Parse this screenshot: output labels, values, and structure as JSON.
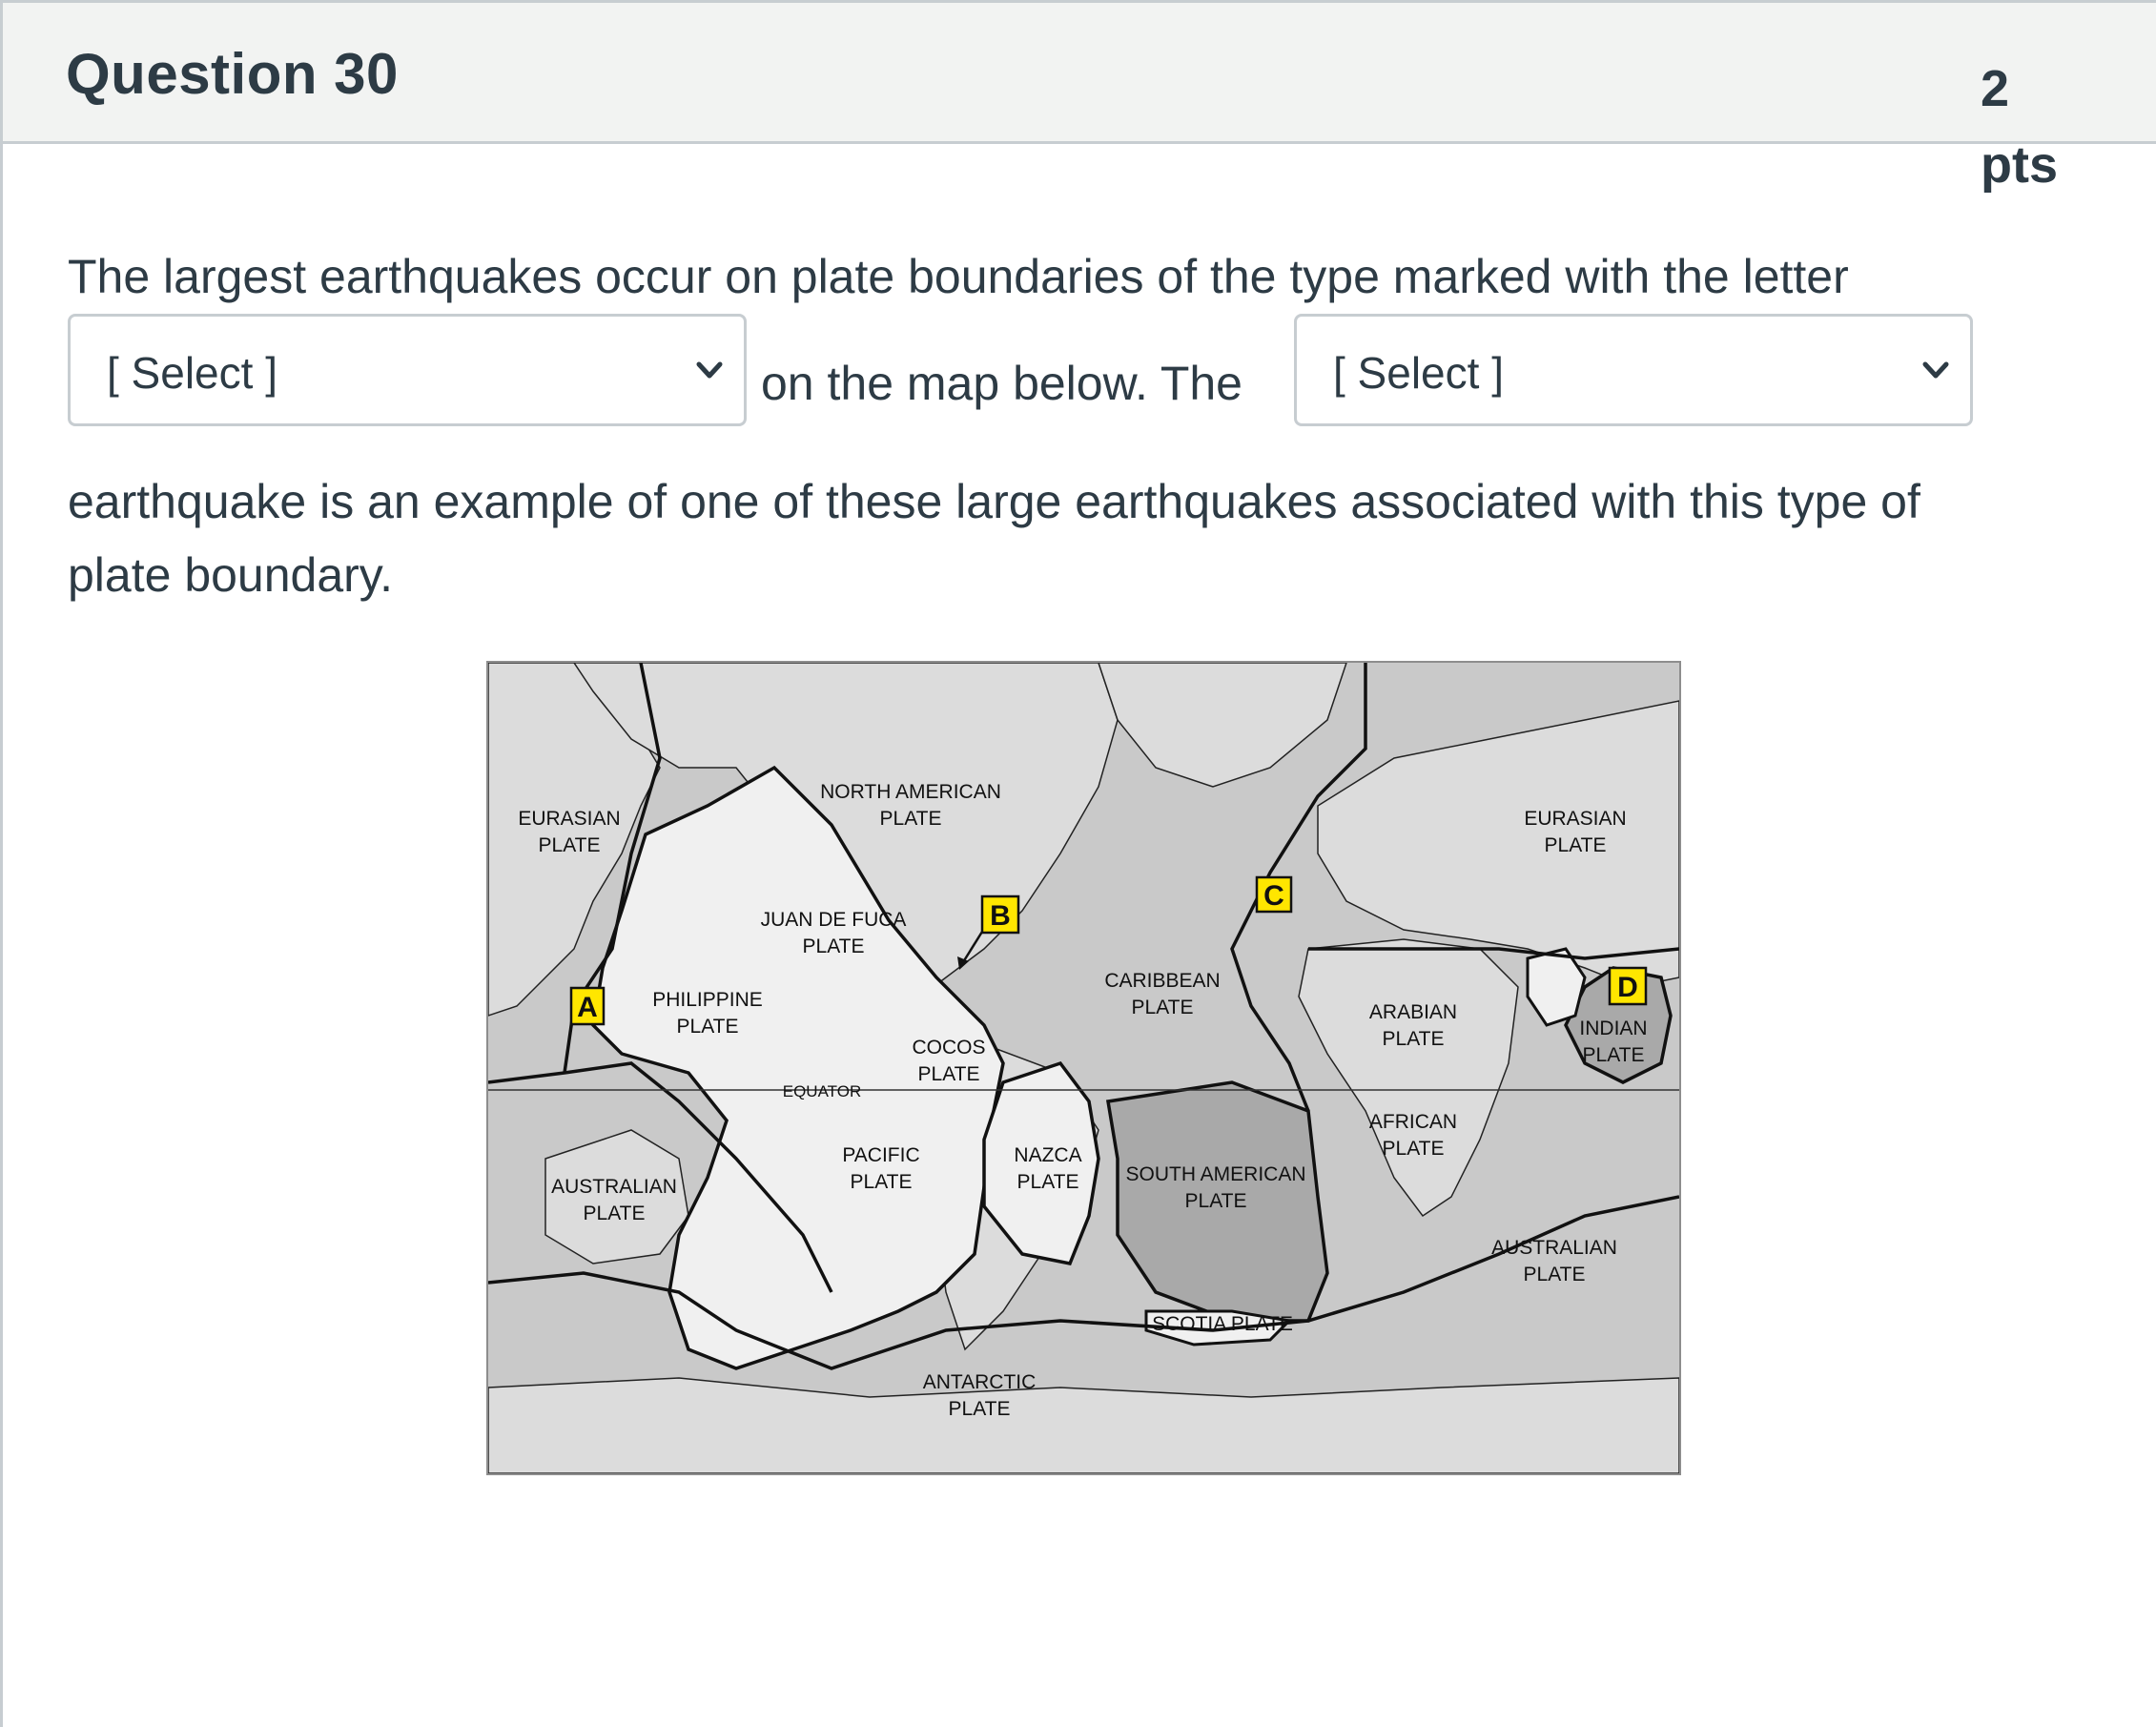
{
  "question": {
    "title": "Question 30",
    "points_number": "2",
    "points_unit": "pts"
  },
  "prompt": {
    "line1": "The largest earthquakes occur on plate boundaries of the type marked with the letter",
    "middle": "on the map below.  The",
    "line3": "earthquake is an example of one of these large earthquakes associated with this type of",
    "line4": "plate boundary."
  },
  "selects": {
    "letter": {
      "value": "[ Select ]",
      "icon": "chevron-down-icon"
    },
    "earthquake": {
      "value": "[ Select ]",
      "icon": "chevron-down-icon"
    }
  },
  "map": {
    "markers": [
      "A",
      "B",
      "C",
      "D"
    ],
    "equator_label": "EQUATOR",
    "plates": {
      "eurasian_west": [
        "EURASIAN",
        "PLATE"
      ],
      "eurasian_east": [
        "EURASIAN",
        "PLATE"
      ],
      "north_american": [
        "NORTH AMERICAN",
        "PLATE"
      ],
      "juan_de_fuca": [
        "JUAN DE FUCA",
        "PLATE"
      ],
      "philippine": [
        "PHILIPPINE",
        "PLATE"
      ],
      "caribbean": [
        "CARIBBEAN",
        "PLATE"
      ],
      "cocos": [
        "COCOS",
        "PLATE"
      ],
      "arabian": [
        "ARABIAN",
        "PLATE"
      ],
      "indian": [
        "INDIAN",
        "PLATE"
      ],
      "african": [
        "AFRICAN",
        "PLATE"
      ],
      "pacific": [
        "PACIFIC",
        "PLATE"
      ],
      "nazca": [
        "NAZCA",
        "PLATE"
      ],
      "south_american": [
        "SOUTH AMERICAN",
        "PLATE"
      ],
      "australian_west": [
        "AUSTRALIAN",
        "PLATE"
      ],
      "australian_east": [
        "AUSTRALIAN",
        "PLATE"
      ],
      "scotia": "SCOTIA PLATE",
      "antarctic": [
        "ANTARCTIC",
        "PLATE"
      ]
    },
    "colors": {
      "ocean": "#c9c9c9",
      "land": "#dcdcdc",
      "pacific_plate": "#f0f0f0",
      "marker": "#ffe600"
    }
  }
}
